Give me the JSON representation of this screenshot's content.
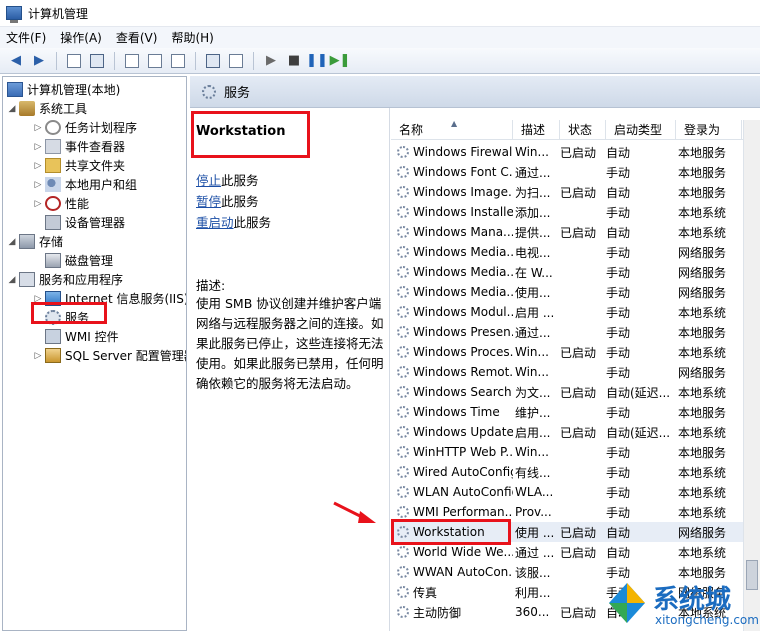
{
  "window": {
    "title": "计算机管理"
  },
  "menu": [
    "文件(F)",
    "操作(A)",
    "查看(V)",
    "帮助(H)"
  ],
  "tree": {
    "root": "计算机管理(本地)",
    "system_tools": "系统工具",
    "task_scheduler": "任务计划程序",
    "event_viewer": "事件查看器",
    "shared_folders": "共享文件夹",
    "local_users": "本地用户和组",
    "performance": "性能",
    "device_manager": "设备管理器",
    "storage": "存储",
    "disk_management": "磁盘管理",
    "services_apps": "服务和应用程序",
    "iis": "Internet 信息服务(IIS)管",
    "services": "服务",
    "wmi": "WMI 控件",
    "sql": "SQL Server 配置管理器"
  },
  "header": {
    "title": "服务"
  },
  "detail": {
    "service_name": "Workstation",
    "stop_link": "停止",
    "stop_suffix": "此服务",
    "pause_link": "暂停",
    "pause_suffix": "此服务",
    "restart_link": "重启动",
    "restart_suffix": "此服务",
    "desc_label": "描述:",
    "desc_text": "使用 SMB 协议创建并维护客户端网络与远程服务器之间的连接。如果此服务已停止，这些连接将无法使用。如果此服务已禁用，任何明确依赖它的服务将无法启动。"
  },
  "columns": {
    "name": "名称",
    "desc": "描述",
    "status": "状态",
    "start": "启动类型",
    "logon": "登录为"
  },
  "services": [
    {
      "name": "Windows Firewall",
      "desc": "Win...",
      "status": "已启动",
      "start": "自动",
      "logon": "本地服务"
    },
    {
      "name": "Windows Font C...",
      "desc": "通过...",
      "status": "",
      "start": "手动",
      "logon": "本地服务"
    },
    {
      "name": "Windows Image...",
      "desc": "为扫...",
      "status": "已启动",
      "start": "自动",
      "logon": "本地服务"
    },
    {
      "name": "Windows Installer",
      "desc": "添加...",
      "status": "",
      "start": "手动",
      "logon": "本地系统"
    },
    {
      "name": "Windows Mana...",
      "desc": "提供...",
      "status": "已启动",
      "start": "自动",
      "logon": "本地系统"
    },
    {
      "name": "Windows Media...",
      "desc": "电视...",
      "status": "",
      "start": "手动",
      "logon": "网络服务"
    },
    {
      "name": "Windows Media...",
      "desc": "在 W...",
      "status": "",
      "start": "手动",
      "logon": "网络服务"
    },
    {
      "name": "Windows Media...",
      "desc": "使用...",
      "status": "",
      "start": "手动",
      "logon": "网络服务"
    },
    {
      "name": "Windows Modul...",
      "desc": "启用 ...",
      "status": "",
      "start": "手动",
      "logon": "本地系统"
    },
    {
      "name": "Windows Presen...",
      "desc": "通过...",
      "status": "",
      "start": "手动",
      "logon": "本地服务"
    },
    {
      "name": "Windows Proces...",
      "desc": "Win...",
      "status": "已启动",
      "start": "手动",
      "logon": "本地系统"
    },
    {
      "name": "Windows Remot...",
      "desc": "Win...",
      "status": "",
      "start": "手动",
      "logon": "网络服务"
    },
    {
      "name": "Windows Search",
      "desc": "为文...",
      "status": "已启动",
      "start": "自动(延迟...",
      "logon": "本地系统"
    },
    {
      "name": "Windows Time",
      "desc": "维护...",
      "status": "",
      "start": "手动",
      "logon": "本地服务"
    },
    {
      "name": "Windows Update",
      "desc": "启用...",
      "status": "已启动",
      "start": "自动(延迟...",
      "logon": "本地系统"
    },
    {
      "name": "WinHTTP Web P...",
      "desc": "Win...",
      "status": "",
      "start": "手动",
      "logon": "本地服务"
    },
    {
      "name": "Wired AutoConfig",
      "desc": "有线...",
      "status": "",
      "start": "手动",
      "logon": "本地系统"
    },
    {
      "name": "WLAN AutoConfig",
      "desc": "WLA...",
      "status": "",
      "start": "手动",
      "logon": "本地系统"
    },
    {
      "name": "WMI Performan...",
      "desc": "Prov...",
      "status": "",
      "start": "手动",
      "logon": "本地系统"
    },
    {
      "name": "Workstation",
      "desc": "使用 ...",
      "status": "已启动",
      "start": "自动",
      "logon": "网络服务"
    },
    {
      "name": "World Wide We...",
      "desc": "通过 ...",
      "status": "已启动",
      "start": "自动",
      "logon": "本地系统"
    },
    {
      "name": "WWAN AutoCon...",
      "desc": "该服...",
      "status": "",
      "start": "手动",
      "logon": "本地服务"
    },
    {
      "name": "传真",
      "desc": "利用...",
      "status": "",
      "start": "手动",
      "logon": "网络服务"
    },
    {
      "name": "主动防御",
      "desc": "360...",
      "status": "已启动",
      "start": "自动",
      "logon": "本地系统"
    }
  ],
  "selected_service_index": 19,
  "watermark": {
    "title": "系统城",
    "subtitle": "xitongcheng.com"
  },
  "colors": {
    "highlight": "#e8121b",
    "link": "#1c4fa6",
    "header_bg": "#ced9e8"
  }
}
